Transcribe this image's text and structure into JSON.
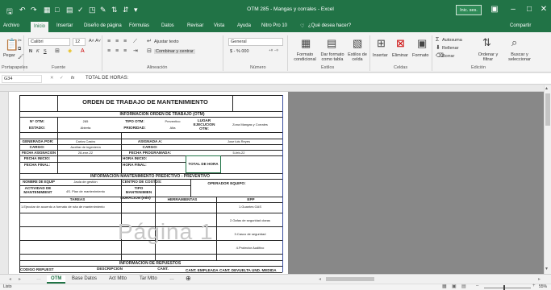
{
  "window": {
    "title": "OTM 285 - Mangas y corrales - Excel",
    "signin": "Inic. ses."
  },
  "tabs": [
    "Archivo",
    "Inicio",
    "Insertar",
    "Diseño de página",
    "Fórmulas",
    "Datos",
    "Revisar",
    "Vista",
    "Ayuda",
    "Nitro Pro 10",
    "¿Qué desea hacer?",
    "Compartir"
  ],
  "ribbon": {
    "paste": "Pegar",
    "font": "Calibri",
    "size": "12",
    "bold": "N",
    "italic": "K",
    "underline": "S",
    "wrap": "Ajustar texto",
    "merge": "Combinar y centrar",
    "number_format": "General",
    "currency": "$ - % 000",
    "conditional": "Formato condicional",
    "table_format": "Dar formato como tabla",
    "styles": "Estilos de celda",
    "insert": "Insertar",
    "delete": "Eliminar",
    "format": "Formato",
    "autosum": "Autosuma",
    "fill": "Rellenar",
    "clear": "Borrar",
    "sort": "Ordenar y filtrar",
    "find": "Buscar y seleccionar",
    "groups": [
      "Portapapeles",
      "Fuente",
      "Alineación",
      "Número",
      "Estilos",
      "Celdas",
      "Edición"
    ]
  },
  "formula": {
    "namebox": "G34",
    "fx": "fx",
    "content": "TOTAL DE HORAS:"
  },
  "sheet": {
    "title": "ORDEN DE TRABAJO DE MANTENIMIENTO",
    "sec1": "INFORMACION ORDEN DE TRABAJO (OTM)",
    "n_otm_label": "N° OTM:",
    "n_otm": "285",
    "tipo_otm_label": "TIPO OTM:",
    "tipo_otm": "Preventivo",
    "lugar_label": "LUGAR EJECUCION OTM:",
    "lugar": "Zona Mangas y Corrales",
    "estado_label": "ESTADO:",
    "estado": "Abierta",
    "prioridad_label": "PRIORIDAD:",
    "prioridad": "Alta",
    "generada_label": "GENERADA POR:",
    "generada": "Carlos Castro",
    "asignada_label": "ASIGNADA A:",
    "asignada": "Jose luis Reyes",
    "cargo_label": "CARGO:",
    "cargo": "Auxiliar de ingeniería",
    "cargo2_label": "CARGO:",
    "fecha_asig_label": "FECHA ASIGNACION",
    "fecha_asig": "28-ene-22",
    "fecha_prog_label": "FECHA PROGRAMADA:",
    "fecha_prog": "5-feb-22",
    "fecha_inicio_label": "FECHA INICIO:",
    "hora_inicio_label": "HORA INICIO:",
    "total_horas_label": "TOTAL DE HORA",
    "fecha_final_label": "FECHA FINAL:",
    "hora_final_label": "HORA FINAL:",
    "sec2": "INFORMACION MANTENIMIENTO PREDICTIVO - PREVENTIVO",
    "nombre_equipo_label": "NOMBRE DE EQUIP",
    "nombre_equipo": "Jaula de gestión",
    "centro_label": "CENTRO DE COSTOS:",
    "operador_label": "OPERADOR EQUIPO:",
    "actividad_label": "ACTIVIDAD DE MANTENIMIENT",
    "actividad": "4S. Plan de mantenimiento",
    "tipo_mant_label": "TIPO MANTENIMIEN",
    "tareas_label": "TAREAS",
    "duracion_label": "DURACION (min)",
    "herramientas_label": "HERRAMIENTAS",
    "epp_label": "EPP",
    "tarea1": "1.Ejecutar de acuerdo a formato de ruta de mantenimiento",
    "epp": [
      "1.Guantes GAS",
      "2.Gafas de seguridad claras",
      "3.Casco de seguridad",
      "4.Protector Auditivo"
    ],
    "sec3": "INFORMACION DE REPUESTOS",
    "rep_headers": [
      "CODIGO REPUEST",
      "DESCRIPCION",
      "CANT.",
      "CANT. EMPLEADA",
      "CANT. DEVUELTA",
      "UND. MEDIDA"
    ]
  },
  "watermark": "Página 1",
  "sheet_tabs": [
    "OTM",
    "Base Datos",
    "Act Mtto",
    "Tar Mtto"
  ],
  "status": {
    "left": "Listo",
    "zoom": "55%"
  }
}
